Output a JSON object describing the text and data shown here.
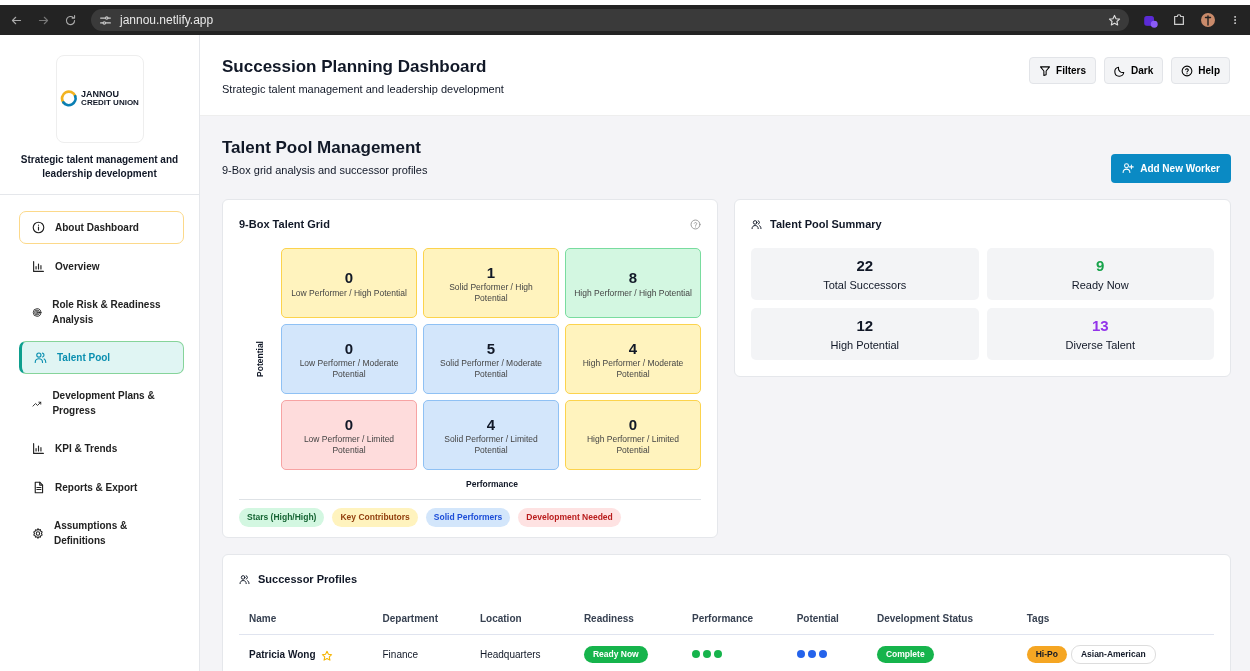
{
  "browser": {
    "url": "jannou.netlify.app"
  },
  "sidebar": {
    "logo": {
      "name": "JANNOU",
      "sub": "CREDIT UNION"
    },
    "tagline": "Strategic talent management and leadership development",
    "items": [
      {
        "label": "About Dashboard",
        "kind": "about",
        "selected": false
      },
      {
        "label": "Overview",
        "kind": "chart",
        "selected": false
      },
      {
        "label": "Role Risk & Readiness Analysis",
        "kind": "target",
        "selected": false
      },
      {
        "label": "Talent Pool",
        "kind": "people",
        "selected": true
      },
      {
        "label": "Development Plans & Progress",
        "kind": "trend",
        "selected": false
      },
      {
        "label": "KPI & Trends",
        "kind": "chart",
        "selected": false
      },
      {
        "label": "Reports & Export",
        "kind": "doc",
        "selected": false
      },
      {
        "label": "Assumptions & Definitions",
        "kind": "gear",
        "selected": false
      }
    ]
  },
  "header": {
    "title": "Succession Planning Dashboard",
    "subtitle": "Strategic talent management and leadership development",
    "buttons": [
      {
        "label": "Filters",
        "kind": "filter"
      },
      {
        "label": "Dark",
        "kind": "moon"
      },
      {
        "label": "Help",
        "kind": "help"
      }
    ]
  },
  "section": {
    "title": "Talent Pool Management",
    "subtitle": "9-Box grid analysis and successor profiles",
    "action": "Add New Worker"
  },
  "grid": {
    "title": "9-Box Talent Grid",
    "y_axis": "Potential",
    "x_axis": "Performance",
    "cells": [
      {
        "count": "0",
        "label": "Low Performer / High Potential",
        "kind": "key"
      },
      {
        "count": "1",
        "label": "Solid Performer / High Potential",
        "kind": "key"
      },
      {
        "count": "8",
        "label": "High Performer / High Potential",
        "kind": "star"
      },
      {
        "count": "0",
        "label": "Low Performer / Moderate Potential",
        "kind": "solid"
      },
      {
        "count": "5",
        "label": "Solid Performer / Moderate Potential",
        "kind": "solid"
      },
      {
        "count": "4",
        "label": "High Performer / Moderate Potential",
        "kind": "key"
      },
      {
        "count": "0",
        "label": "Low Performer / Limited Potential",
        "kind": "dev"
      },
      {
        "count": "4",
        "label": "Solid Performer / Limited Potential",
        "kind": "solid"
      },
      {
        "count": "0",
        "label": "High Performer / Limited Potential",
        "kind": "key"
      }
    ],
    "legend": [
      {
        "label": "Stars (High/High)",
        "kind": "star"
      },
      {
        "label": "Key Contributors",
        "kind": "key"
      },
      {
        "label": "Solid Performers",
        "kind": "solid"
      },
      {
        "label": "Development Needed",
        "kind": "dev"
      }
    ]
  },
  "summary": {
    "title": "Talent Pool Summary",
    "stats": [
      {
        "value": "22",
        "label": "Total Successors",
        "color": "#111827"
      },
      {
        "value": "9",
        "label": "Ready Now",
        "color": "#16a34a"
      },
      {
        "value": "12",
        "label": "High Potential",
        "color": "#111827"
      },
      {
        "value": "13",
        "label": "Diverse Talent",
        "color": "#9333ea"
      }
    ]
  },
  "profiles": {
    "title": "Successor Profiles",
    "columns": [
      "Name",
      "Department",
      "Location",
      "Readiness",
      "Performance",
      "Potential",
      "Development Status",
      "Tags"
    ],
    "rows": [
      {
        "name": "Patricia Wong",
        "department": "Finance",
        "location": "Headquarters",
        "readiness": "Ready Now",
        "performance": {
          "stars": 3
        },
        "potential": {
          "stars": 3
        },
        "status": "Complete",
        "tags": [
          {
            "label": "Hi-Po",
            "kind": "hipo"
          },
          {
            "label": "Asian-American",
            "kind": "plain"
          }
        ]
      }
    ]
  }
}
